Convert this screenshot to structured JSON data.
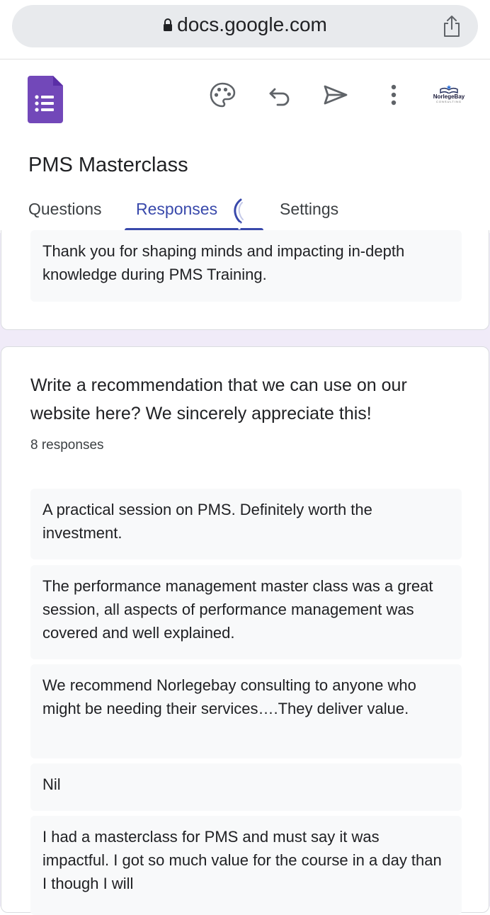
{
  "browser": {
    "url": "docs.google.com",
    "lock_icon": "lock-icon",
    "share_icon": "share-icon"
  },
  "toolbar": {
    "app_icon": "google-forms-icon",
    "icons": [
      "palette-icon",
      "undo-icon",
      "send-icon",
      "more-vert-icon"
    ],
    "brand": {
      "name": "NorlegeBay",
      "sub": "CONSULTING"
    }
  },
  "form": {
    "title": "PMS Masterclass"
  },
  "tabs": [
    {
      "label": "Questions",
      "active": false
    },
    {
      "label": "Responses",
      "active": true
    },
    {
      "label": "Settings",
      "active": false
    }
  ],
  "previous_card": {
    "last_response": "Thank you for shaping minds and impacting in-depth knowledge during PMS Training."
  },
  "question": {
    "text": "Write a recommendation that we can use on our website here? We sincerely appreciate this!",
    "response_count": "8 responses",
    "responses": [
      "A practical session on PMS. Definitely worth the investment.",
      "The performance management master class was a great session, all aspects of performance management was covered and well explained.",
      "We recommend Norlegebay consulting to anyone who might be needing their services….They deliver value.",
      "Nil",
      "I had a masterclass for PMS and must say it was impactful. I got so much value for the course in a day than I though I will"
    ]
  },
  "colors": {
    "accent": "#3949ab",
    "forms_purple": "#7248b9",
    "page_bg": "#f0ebf8",
    "response_bg": "#f8f9fa"
  }
}
